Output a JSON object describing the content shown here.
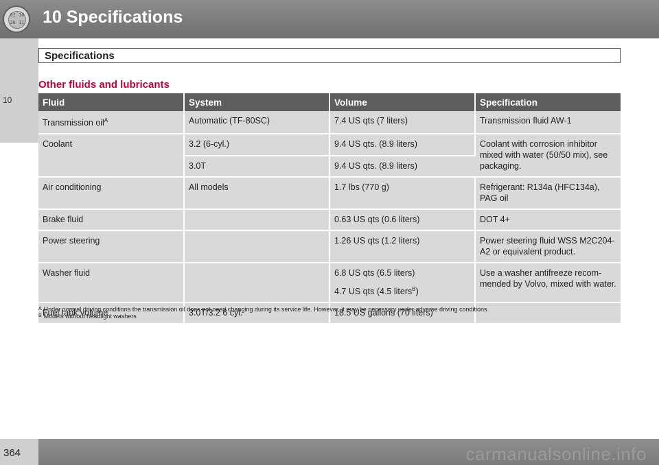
{
  "header": {
    "chapter_title": "10 Specifications",
    "badge_text": "01 10 20 11"
  },
  "sidebar": {
    "chapter_number": "10"
  },
  "section": {
    "title": "Specifications"
  },
  "table": {
    "heading": "Other fluids and lubricants",
    "columns": [
      "Fluid",
      "System",
      "Volume",
      "Specification"
    ],
    "rows": {
      "transmission": {
        "fluid": "Transmission oil",
        "fluid_sup": "A",
        "system": "Automatic (TF-80SC)",
        "volume": "7.4 US qts (7 liters)",
        "spec": "Transmission fluid AW-1"
      },
      "coolant": {
        "fluid": "Coolant",
        "system_1": "3.2 (6-cyl.)",
        "volume_1": "9.4 US qts. (8.9 liters)",
        "system_2": "3.0T",
        "volume_2": "9.4 US qts. (8.9 liters)",
        "spec": "Coolant with corrosion inhibitor mixed with water (50/50 mix), see packaging."
      },
      "air_conditioning": {
        "fluid": "Air conditioning",
        "system": "All models",
        "volume": "1.7 lbs (770 g)",
        "spec": "Refrigerant: R134a (HFC134a), PAG oil"
      },
      "brake": {
        "fluid": "Brake fluid",
        "system": "",
        "volume": "0.63 US qts (0.6 liters)",
        "spec": "DOT 4+"
      },
      "power_steering": {
        "fluid": "Power steering",
        "system": "",
        "volume": "1.26 US qts (1.2 liters)",
        "spec": "Power steering fluid WSS M2C204-A2 or equivalent product."
      },
      "washer": {
        "fluid": "Washer fluid",
        "system": "",
        "volume_1": "6.8 US qts (6.5 liters)",
        "volume_2": "4.7 US qts (4.5 liters",
        "volume_2_sup": "B",
        "volume_2_end": ")",
        "spec": "Use a washer antifreeze recom-mended by Volvo, mixed with water."
      },
      "fuel_tank": {
        "fluid": "Fuel tank volume",
        "system": "3.0T/3.2 6 cyl.",
        "volume": "18.5 US gallons (70 liters)",
        "spec": ""
      }
    }
  },
  "footnotes": [
    {
      "mark": "A",
      "text": "Under normal driving conditions the transmission oil does not need changing during its service life. However, it may be necessary under adverse driving conditions."
    },
    {
      "mark": "B",
      "text": "Models without headlight washers"
    }
  ],
  "footer": {
    "page_number": "364",
    "watermark": "carmanualsonline.info"
  }
}
